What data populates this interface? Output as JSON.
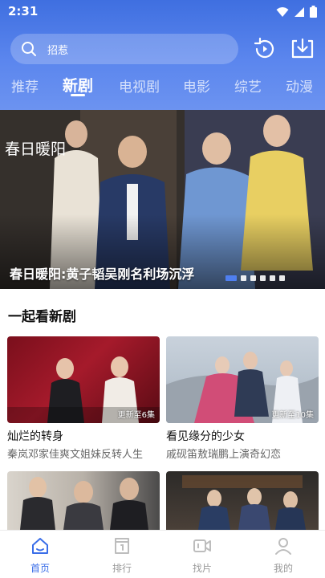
{
  "status_bar": {
    "time": "2:31"
  },
  "search": {
    "placeholder": "招惹"
  },
  "tabs": [
    {
      "label": "推荐",
      "active": false
    },
    {
      "label": "新剧",
      "active": true
    },
    {
      "label": "电视剧",
      "active": false
    },
    {
      "label": "电影",
      "active": false
    },
    {
      "label": "综艺",
      "active": false
    },
    {
      "label": "动漫",
      "active": false
    }
  ],
  "banner": {
    "logo_text": "春日暖阳",
    "title": "春日暖阳:黄子韬吴刚名利场沉浮",
    "page_count": 6,
    "active_index": 0
  },
  "section": {
    "title": "一起看新剧"
  },
  "cards": [
    {
      "title": "灿烂的转身",
      "desc": "秦岚邓家佳爽文姐妹反转人生",
      "badge": "更新至6集"
    },
    {
      "title": "看见缘分的少女",
      "desc": "戚砚笛敖瑞鹏上演奇幻恋",
      "badge": "更新至10集"
    },
    {
      "title": "",
      "desc": "",
      "badge": ""
    },
    {
      "title": "",
      "desc": "",
      "badge": ""
    }
  ],
  "bottom_nav": [
    {
      "label": "首页",
      "icon": "home-icon",
      "active": true
    },
    {
      "label": "排行",
      "icon": "ranking-icon",
      "active": false
    },
    {
      "label": "找片",
      "icon": "video-search-icon",
      "active": false
    },
    {
      "label": "我的",
      "icon": "profile-icon",
      "active": false
    }
  ],
  "colors": {
    "header_blue": "#4a78e8",
    "accent": "#3a6ee8",
    "nav_inactive": "#9a9a9a"
  }
}
